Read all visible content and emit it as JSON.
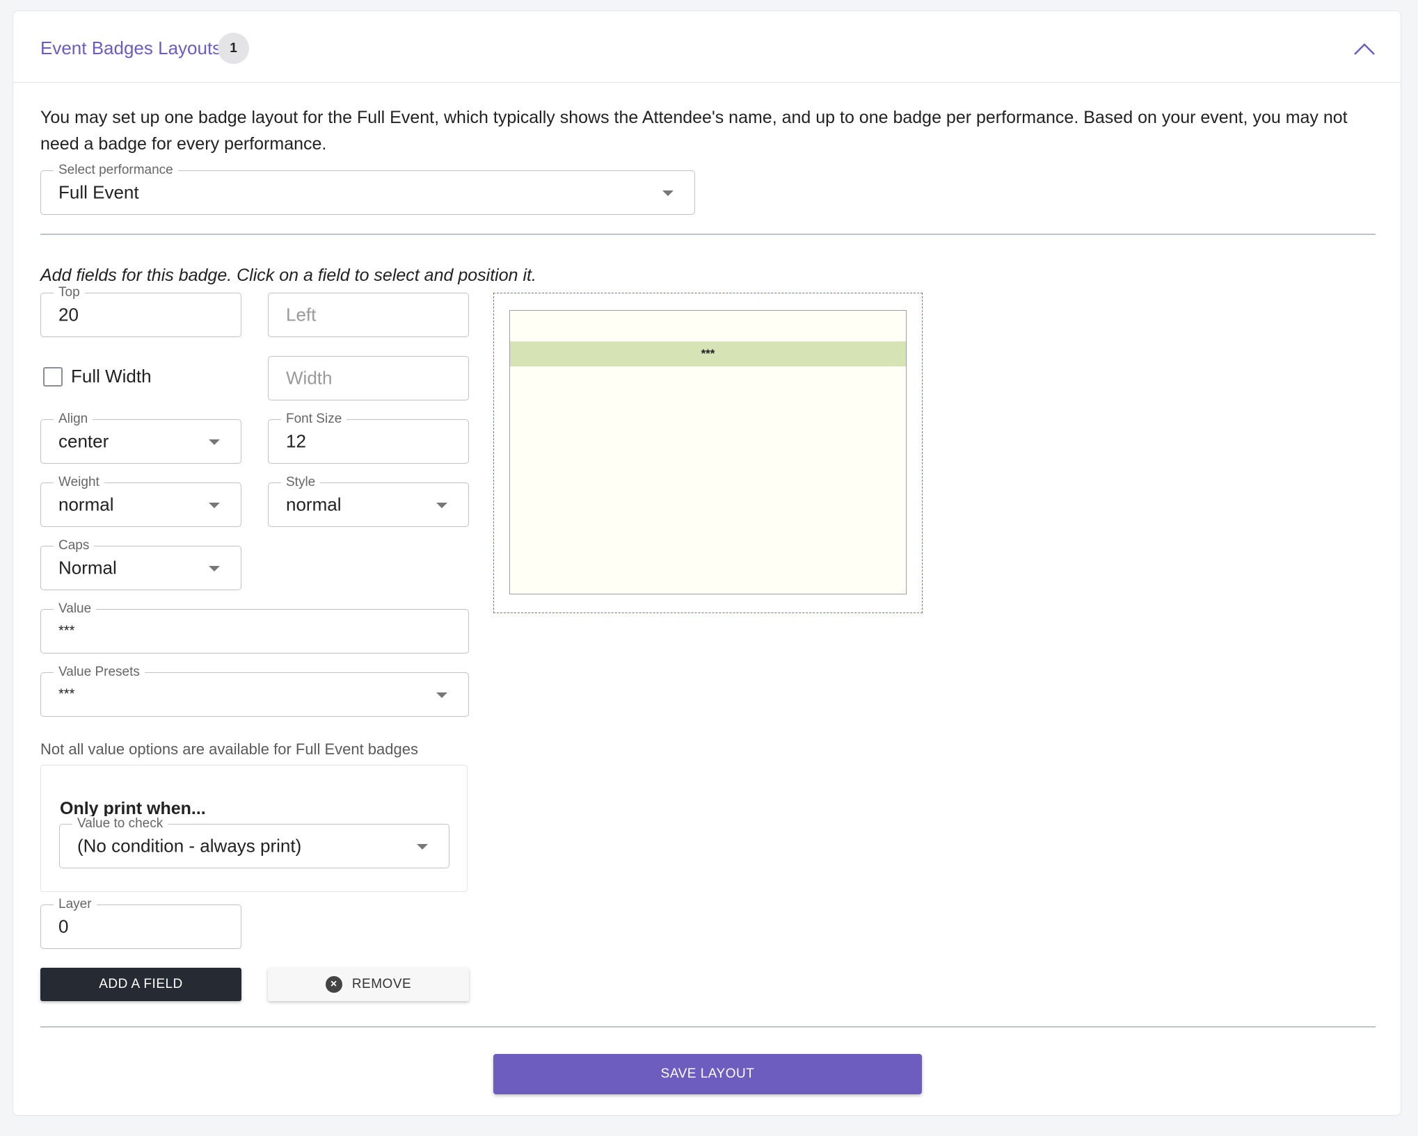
{
  "header": {
    "title": "Event Badges Layouts",
    "count": "1"
  },
  "intro": "You may set up one badge layout for the Full Event, which typically shows the Attendee's name, and up to one badge per performance. Based on your event, you may not need a badge for every performance.",
  "performance_select": {
    "label": "Select performance",
    "value": "Full Event"
  },
  "instructions": "Add fields for this badge. Click on a field to select and position it.",
  "fields": {
    "top": {
      "label": "Top",
      "value": "20"
    },
    "left": {
      "placeholder": "Left"
    },
    "full_width": {
      "label": "Full Width",
      "checked": false
    },
    "width": {
      "placeholder": "Width"
    },
    "align": {
      "label": "Align",
      "value": "center"
    },
    "font_size": {
      "label": "Font Size",
      "value": "12"
    },
    "weight": {
      "label": "Weight",
      "value": "normal"
    },
    "style": {
      "label": "Style",
      "value": "normal"
    },
    "caps": {
      "label": "Caps",
      "value": "Normal"
    },
    "value": {
      "label": "Value",
      "value": "***"
    },
    "value_presets": {
      "label": "Value Presets",
      "value": "***"
    },
    "hint": "Not all value options are available for Full Event badges",
    "condition": {
      "title": "Only print when...",
      "label": "Value to check",
      "value": "(No condition - always print)"
    },
    "layer": {
      "label": "Layer",
      "value": "0"
    }
  },
  "buttons": {
    "add_field": "ADD A FIELD",
    "remove": "REMOVE",
    "save": "SAVE LAYOUT"
  },
  "preview": {
    "field_text": "***"
  },
  "colors": {
    "accent": "#6c5dbf",
    "dark_button": "#262a33",
    "badge_bg": "#fffff6",
    "field_highlight": "#d5e3b5",
    "preview_border": "#d9534f"
  }
}
